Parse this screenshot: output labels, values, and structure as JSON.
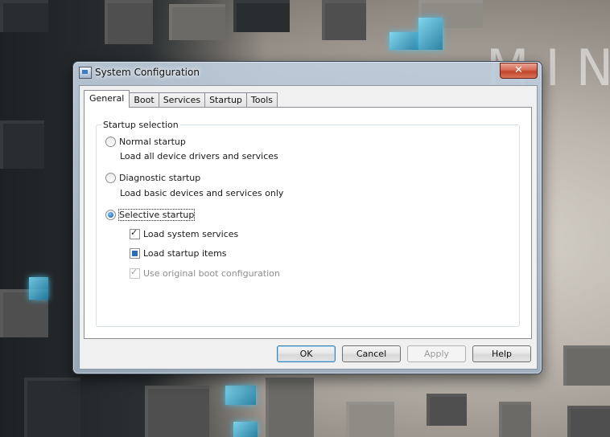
{
  "desktop": {
    "wallpaper_text": "MIN"
  },
  "window": {
    "title": "System Configuration",
    "close_glyph": "✕"
  },
  "tabs": [
    {
      "label": "General",
      "active": true
    },
    {
      "label": "Boot"
    },
    {
      "label": "Services"
    },
    {
      "label": "Startup"
    },
    {
      "label": "Tools"
    }
  ],
  "startup_selection": {
    "legend": "Startup selection",
    "normal": {
      "label": "Normal startup",
      "desc": "Load all device drivers and services",
      "checked": false
    },
    "diagnostic": {
      "label": "Diagnostic startup",
      "desc": "Load basic devices and services only",
      "checked": false
    },
    "selective": {
      "label": "Selective startup",
      "checked": true
    },
    "load_system_services": {
      "label": "Load system services",
      "state": "checked"
    },
    "load_startup_items": {
      "label": "Load startup items",
      "state": "indeterminate"
    },
    "use_original_boot": {
      "label": "Use original boot configuration",
      "state": "checked-disabled"
    }
  },
  "buttons": {
    "ok": "OK",
    "cancel": "Cancel",
    "apply": "Apply",
    "help": "Help"
  },
  "colors": {
    "accent": "#3c7fb1",
    "close_red": "#c2432b",
    "glow_cyan": "#49c5f0"
  }
}
